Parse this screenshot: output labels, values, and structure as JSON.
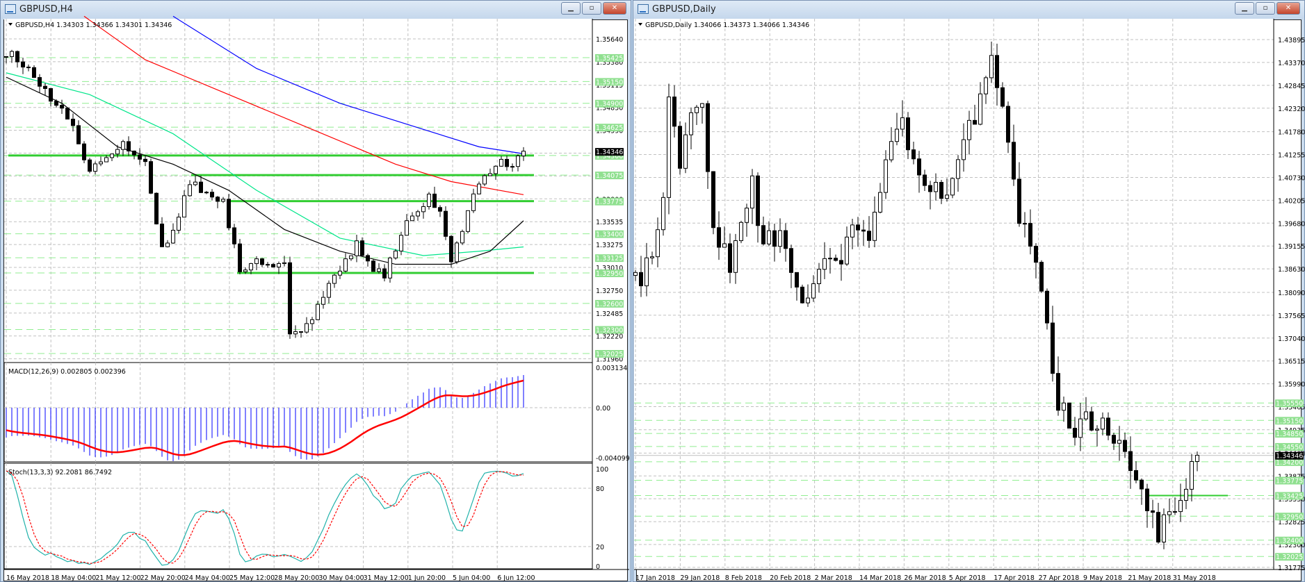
{
  "left_window": {
    "title": "GBPUSD,H4",
    "header": "GBPUSD,H4  1.34303 1.34366 1.34301 1.34346",
    "buttons": {
      "minimize": "▁",
      "restore": "▫",
      "close": "✕"
    },
    "price_ticks": [
      "1.35640",
      "1.35380",
      "1.35115",
      "1.34850",
      "1.34590",
      "1.34325",
      "1.34060",
      "1.33800",
      "1.33535",
      "1.33275",
      "1.33010",
      "1.32750",
      "1.32485",
      "1.32220",
      "1.31960"
    ],
    "level_labels": [
      "1.35425",
      "1.35150",
      "1.34900",
      "1.34625",
      "1.34300",
      "1.34075",
      "1.33775",
      "1.33400",
      "1.33125",
      "1.32950",
      "1.32600",
      "1.32300",
      "1.32025"
    ],
    "solid_levels": [
      1.343,
      1.34075,
      1.33775,
      1.3295
    ],
    "current_price": "1.34346",
    "time_labels": [
      "16 May 2018",
      "18 May 04:00",
      "21 May 12:00",
      "22 May 20:00",
      "24 May 04:00",
      "25 May 12:00",
      "28 May 20:00",
      "30 May 04:00",
      "31 May 12:00",
      "1 Jun 20:00",
      "5 Jun 04:00",
      "6 Jun 12:00"
    ],
    "macd": {
      "label": "MACD(12,26,9) 0.002805 0.002396",
      "ticks": [
        "0.003134",
        "0.00",
        "-0.004099"
      ]
    },
    "stoch": {
      "label": "Stoch(13,3,3) 92.2081 86.7492",
      "ticks": [
        "100",
        "80",
        "20",
        "0"
      ]
    },
    "anchors": [
      [
        0,
        1.354
      ],
      [
        1,
        1.3545
      ],
      [
        5,
        1.352
      ],
      [
        9,
        1.349
      ],
      [
        12,
        1.346
      ],
      [
        15,
        1.3415
      ],
      [
        18,
        1.343
      ],
      [
        21,
        1.3445
      ],
      [
        25,
        1.3425
      ],
      [
        28,
        1.332
      ],
      [
        30,
        1.334
      ],
      [
        33,
        1.34
      ],
      [
        36,
        1.339
      ],
      [
        39,
        1.3375
      ],
      [
        42,
        1.33
      ],
      [
        46,
        1.331
      ],
      [
        50,
        1.3305
      ],
      [
        51,
        1.3225
      ],
      [
        54,
        1.3235
      ],
      [
        59,
        1.329
      ],
      [
        63,
        1.333
      ],
      [
        66,
        1.33
      ],
      [
        68,
        1.329
      ],
      [
        71,
        1.334
      ],
      [
        74,
        1.337
      ],
      [
        76,
        1.338
      ],
      [
        78,
        1.336
      ],
      [
        80,
        1.3305
      ],
      [
        83,
        1.337
      ],
      [
        86,
        1.3405
      ],
      [
        89,
        1.342
      ],
      [
        91,
        1.3415
      ],
      [
        93,
        1.3435
      ]
    ],
    "moving_averages": [
      {
        "color": "#0000ff",
        "points": [
          [
            30,
            1.359
          ],
          [
            45,
            1.353
          ],
          [
            60,
            1.349
          ],
          [
            75,
            1.346
          ],
          [
            85,
            1.344
          ],
          [
            93,
            1.3432
          ]
        ]
      },
      {
        "color": "#ff0000",
        "points": [
          [
            14,
            1.359
          ],
          [
            25,
            1.354
          ],
          [
            40,
            1.35
          ],
          [
            55,
            1.346
          ],
          [
            70,
            1.342
          ],
          [
            80,
            1.34
          ],
          [
            93,
            1.3385
          ]
        ]
      },
      {
        "color": "#00e68a",
        "points": [
          [
            0,
            1.3525
          ],
          [
            15,
            1.35
          ],
          [
            30,
            1.3455
          ],
          [
            45,
            1.339
          ],
          [
            60,
            1.3335
          ],
          [
            75,
            1.3315
          ],
          [
            85,
            1.332
          ],
          [
            93,
            1.3325
          ]
        ]
      },
      {
        "color": "#000000",
        "points": [
          [
            0,
            1.352
          ],
          [
            10,
            1.349
          ],
          [
            20,
            1.344
          ],
          [
            30,
            1.342
          ],
          [
            40,
            1.339
          ],
          [
            50,
            1.3345
          ],
          [
            60,
            1.332
          ],
          [
            70,
            1.3305
          ],
          [
            80,
            1.3305
          ],
          [
            87,
            1.332
          ],
          [
            93,
            1.3355
          ]
        ]
      }
    ]
  },
  "right_window": {
    "title": "GBPUSD,Daily",
    "header": "GBPUSD,Daily  1.34066 1.34373 1.34066 1.34346",
    "buttons": {
      "minimize": "▁",
      "restore": "▫",
      "close": "✕"
    },
    "price_ticks": [
      "1.43895",
      "1.43370",
      "1.42845",
      "1.42320",
      "1.41780",
      "1.41255",
      "1.40730",
      "1.40205",
      "1.39680",
      "1.39155",
      "1.38630",
      "1.38090",
      "1.37565",
      "1.37040",
      "1.36515",
      "1.35990",
      "1.35465",
      "1.34935",
      "1.34400",
      "1.33875",
      "1.33350",
      "1.32825",
      "1.32300",
      "1.31775"
    ],
    "level_labels": [
      "1.35550",
      "1.35150",
      "1.34850",
      "1.34550",
      "1.34200",
      "1.33775",
      "1.33425",
      "1.32950",
      "1.32400",
      "1.32025"
    ],
    "solid_level": 1.33425,
    "current_price": "1.34346",
    "time_labels": [
      "17 Jan 2018",
      "29 Jan 2018",
      "8 Feb 2018",
      "20 Feb 2018",
      "2 Mar 2018",
      "14 Mar 2018",
      "26 Mar 2018",
      "5 Apr 2018",
      "17 Apr 2018",
      "27 Apr 2018",
      "9 May 2018",
      "21 May 2018",
      "31 May 2018"
    ],
    "anchors": [
      [
        0,
        1.383
      ],
      [
        3,
        1.388
      ],
      [
        5,
        1.403
      ],
      [
        6,
        1.428
      ],
      [
        8,
        1.412
      ],
      [
        10,
        1.42
      ],
      [
        12,
        1.425
      ],
      [
        14,
        1.398
      ],
      [
        17,
        1.385
      ],
      [
        21,
        1.405
      ],
      [
        23,
        1.393
      ],
      [
        27,
        1.392
      ],
      [
        31,
        1.377
      ],
      [
        33,
        1.385
      ],
      [
        37,
        1.39
      ],
      [
        41,
        1.397
      ],
      [
        42,
        1.394
      ],
      [
        45,
        1.413
      ],
      [
        48,
        1.421
      ],
      [
        52,
        1.403
      ],
      [
        56,
        1.405
      ],
      [
        58,
        1.413
      ],
      [
        62,
        1.425
      ],
      [
        64,
        1.436
      ],
      [
        67,
        1.413
      ],
      [
        69,
        1.398
      ],
      [
        71,
        1.392
      ],
      [
        74,
        1.375
      ],
      [
        76,
        1.355
      ],
      [
        79,
        1.35
      ],
      [
        83,
        1.351
      ],
      [
        87,
        1.346
      ],
      [
        91,
        1.334
      ],
      [
        94,
        1.325
      ],
      [
        97,
        1.333
      ],
      [
        101,
        1.3435
      ]
    ]
  }
}
